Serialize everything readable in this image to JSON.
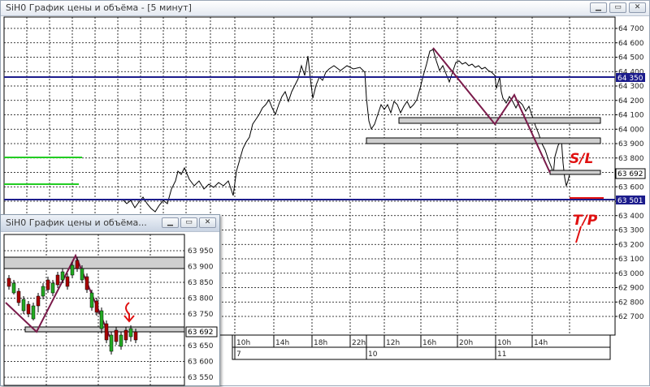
{
  "main_window": {
    "title": "SiH0 График цены и объёма - [5 минут]",
    "buttons": {
      "minimize": "▁",
      "maximize": "▭",
      "close": "✕"
    },
    "y_axis_labels": [
      "64 700",
      "64 600",
      "64 500",
      "64 400",
      "64 300",
      "64 200",
      "64 100",
      "64 000",
      "63 900",
      "63 800",
      "63 700",
      "63 600",
      "63 500",
      "63 400",
      "63 300",
      "63 200",
      "63 100",
      "63 000",
      "62 900",
      "62 800",
      "62 700"
    ],
    "time_labels": [
      "10h",
      "14h",
      "18h",
      "22h",
      "12h",
      "16h",
      "20h",
      "10h",
      "14h"
    ],
    "date_labels": [
      "7",
      "10",
      "11"
    ],
    "price_tags": {
      "upper": "64 350",
      "current": "63 692",
      "lower": "63 501"
    },
    "annotations": {
      "stop_loss": "S/L",
      "take_profit": "T/P"
    },
    "colors": {
      "horizontal_line": "#1c1c8c",
      "trend_line": "#7a1a4a",
      "marker": "#e01010",
      "green_line": "#22cc22",
      "candle": "#000000"
    }
  },
  "inset_window": {
    "title": "SiH0 График цены и объёма...",
    "buttons": {
      "minimize": "▁",
      "maximize": "▭",
      "close": "✕"
    },
    "y_axis_labels": [
      "63 950",
      "63 900",
      "63 850",
      "63 800",
      "63 750",
      "63 700",
      "63 650",
      "63 600",
      "63 550"
    ],
    "price_tag": "63 692"
  }
}
